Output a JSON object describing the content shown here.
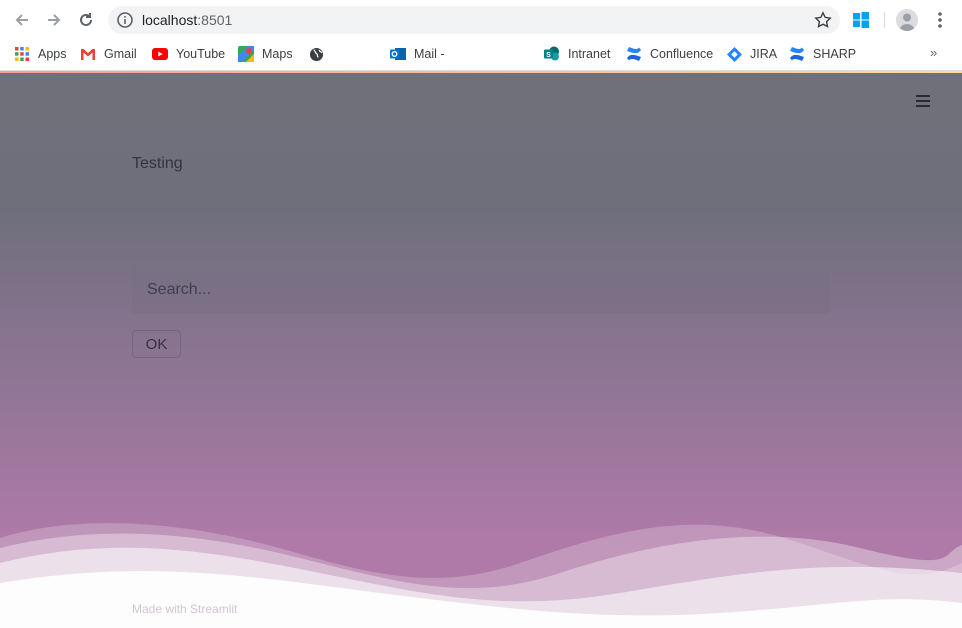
{
  "browser": {
    "url_host": "localhost",
    "url_port": ":8501",
    "bookmarks": [
      {
        "label": "Apps",
        "icon": "apps-grid-icon"
      },
      {
        "label": "Gmail",
        "icon": "gmail-icon"
      },
      {
        "label": "YouTube",
        "icon": "youtube-icon"
      },
      {
        "label": "Maps",
        "icon": "maps-icon"
      },
      {
        "label": "",
        "icon": "globe-icon"
      },
      {
        "label": "Mail -",
        "icon": "outlook-icon"
      },
      {
        "label": "Intranet",
        "icon": "sharepoint-icon"
      },
      {
        "label": "Confluence",
        "icon": "confluence-icon"
      },
      {
        "label": "JIRA",
        "icon": "jira-icon"
      },
      {
        "label": "SHARP",
        "icon": "confluence-icon"
      }
    ],
    "more_label": "»"
  },
  "app": {
    "heading": "Testing",
    "search": {
      "placeholder": "Search...",
      "value": ""
    },
    "ok_label": "OK",
    "footer": "Made with Streamlit"
  },
  "colors": {
    "gradient_top": "#70707b",
    "gradient_bottom": "#b07aa8",
    "text": "#31333f",
    "accent": "#ff4b4b"
  }
}
